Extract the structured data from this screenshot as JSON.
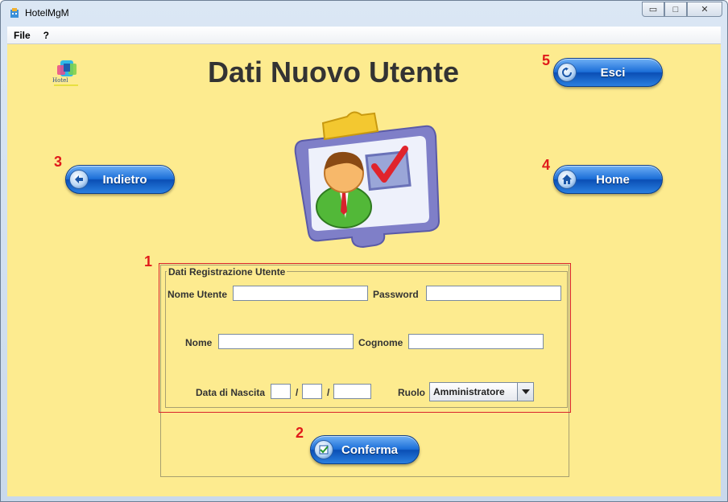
{
  "window": {
    "title": "HotelMgM",
    "controls": {
      "minimize": "▭",
      "maximize": "□",
      "close": "✕"
    }
  },
  "menu": {
    "items": [
      "File",
      "?"
    ]
  },
  "logo": {
    "text": "Hotel"
  },
  "page": {
    "title": "Dati Nuovo Utente"
  },
  "buttons": {
    "exit": {
      "label": "Esci",
      "icon": "exit-icon"
    },
    "back": {
      "label": "Indietro",
      "icon": "back-arrow-icon"
    },
    "home": {
      "label": "Home",
      "icon": "home-icon"
    },
    "confirm": {
      "label": "Conferma",
      "icon": "confirm-check-icon"
    }
  },
  "annotations": {
    "form": "1",
    "confirm": "2",
    "back": "3",
    "home": "4",
    "exit": "5"
  },
  "form": {
    "legend": "Dati Registrazione Utente",
    "username_label": "Nome Utente",
    "username_value": "",
    "password_label": "Password",
    "password_value": "",
    "name_label": "Nome",
    "name_value": "",
    "surname_label": "Cognome",
    "surname_value": "",
    "birthdate_label": "Data di Nascita",
    "birth_day": "",
    "birth_month": "",
    "birth_year": "",
    "date_separator": "/",
    "role_label": "Ruolo",
    "role_selected": "Amministratore"
  },
  "colors": {
    "background": "#fdeb8f",
    "button_blue": "#1c6fd8",
    "annotation_red": "#e01b1b"
  }
}
